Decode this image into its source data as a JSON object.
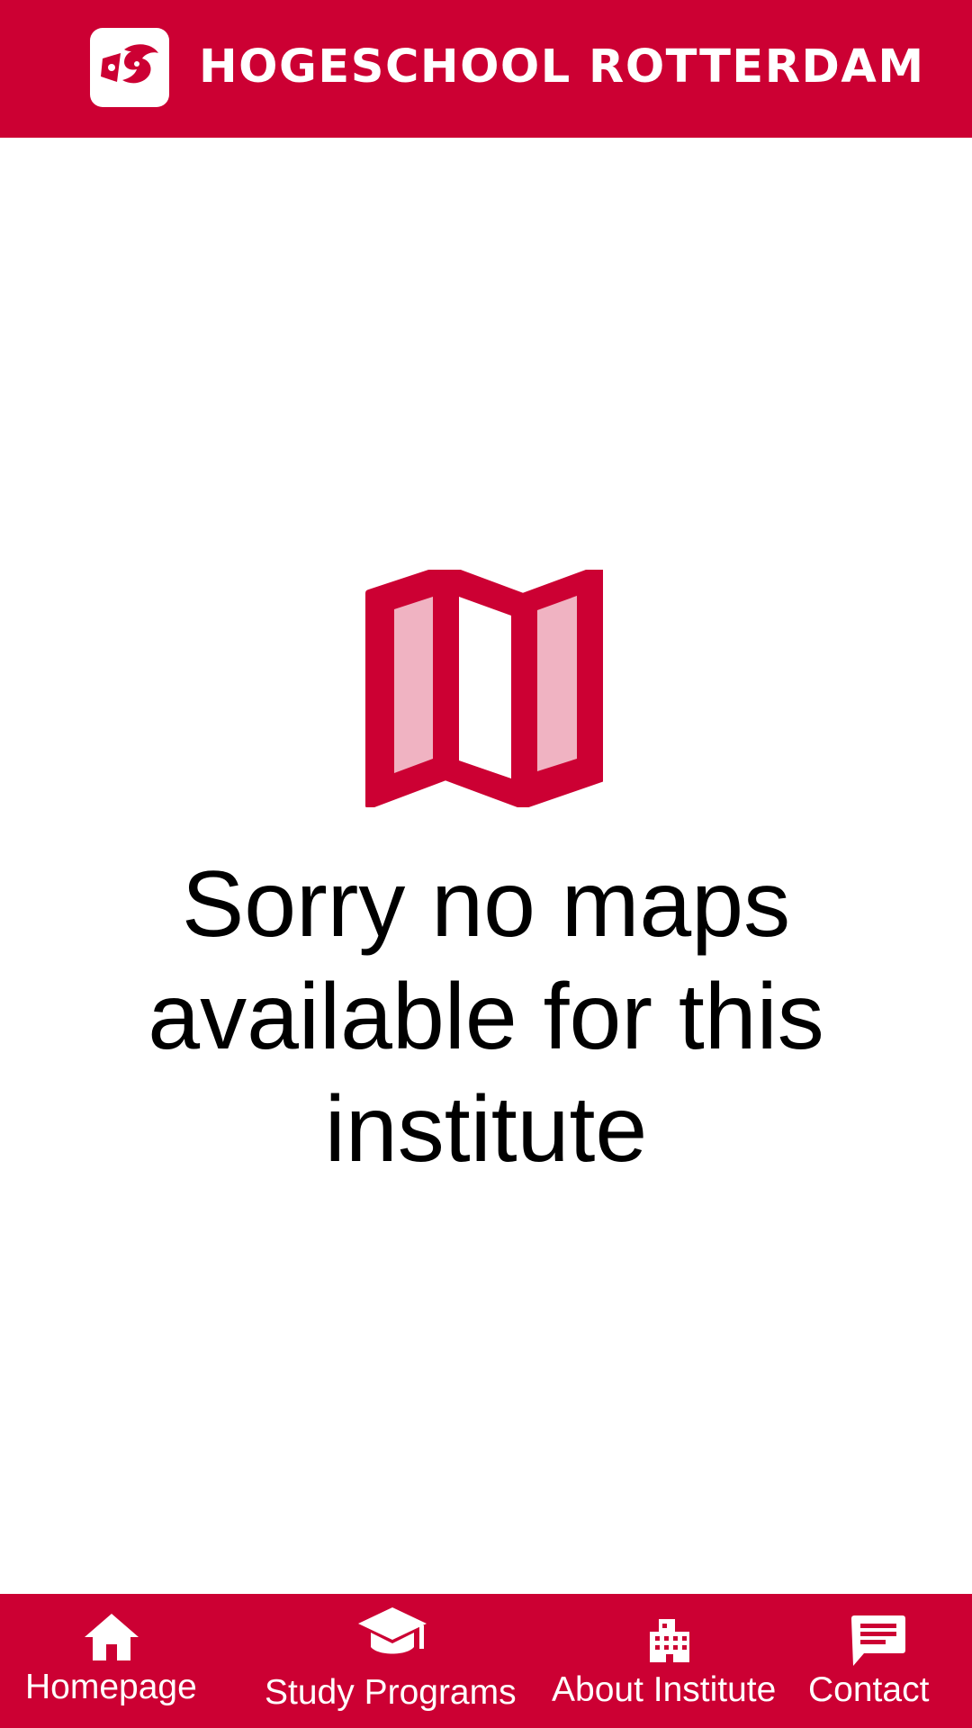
{
  "header": {
    "brand_name": "HOGESCHOOL ROTTERDAM",
    "logo_icon": "hogeschool-rotterdam-logo-icon",
    "background_color": "#cc0033"
  },
  "main": {
    "icon": "map-icon",
    "icon_color": "#cc0033",
    "icon_accent": "#f0b3c2",
    "message": "Sorry no maps available for this institute"
  },
  "bottom_nav": {
    "background_color": "#cc0033",
    "items": [
      {
        "label": "Homepage",
        "icon": "home-icon"
      },
      {
        "label": "Study Programs",
        "icon": "graduation-cap-icon"
      },
      {
        "label": "About Institute",
        "icon": "building-icon"
      },
      {
        "label": "Contact",
        "icon": "chat-icon"
      }
    ]
  }
}
